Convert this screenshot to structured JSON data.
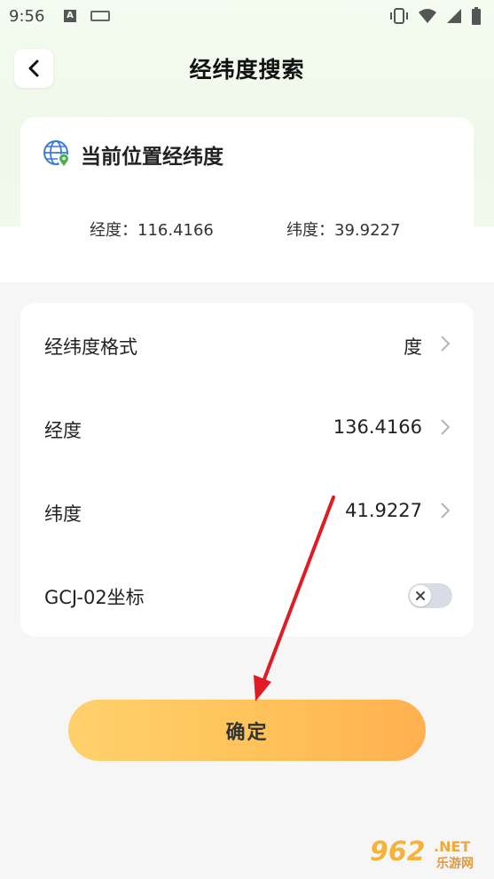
{
  "status_bar": {
    "time": "9:56",
    "icons": [
      "notification-a-icon",
      "keyboard-icon",
      "vibrate-icon",
      "wifi-icon",
      "signal-icon",
      "battery-icon"
    ]
  },
  "header": {
    "title": "经纬度搜索",
    "back_icon": "chevron-left-icon"
  },
  "current_location": {
    "title": "当前位置经纬度",
    "icon": "globe-location-icon",
    "longitude": "经度：116.4166",
    "latitude": "纬度：39.9227"
  },
  "settings": {
    "rows": [
      {
        "label": "经纬度格式",
        "value": "度"
      },
      {
        "label": "经度",
        "value": "136.4166"
      },
      {
        "label": "纬度",
        "value": "41.9227"
      },
      {
        "label": "GCJ-02坐标",
        "toggle": false
      }
    ]
  },
  "confirm": {
    "label": "确定"
  },
  "colors": {
    "accent_start": "#ffd16b",
    "accent_end": "#ffb04f",
    "annotation_arrow": "#e01b24",
    "globe": "#3a7bd5",
    "pin": "#4caf50"
  },
  "watermark": {
    "main": "962",
    "suffix": ".NET",
    "sub": "乐游网"
  }
}
